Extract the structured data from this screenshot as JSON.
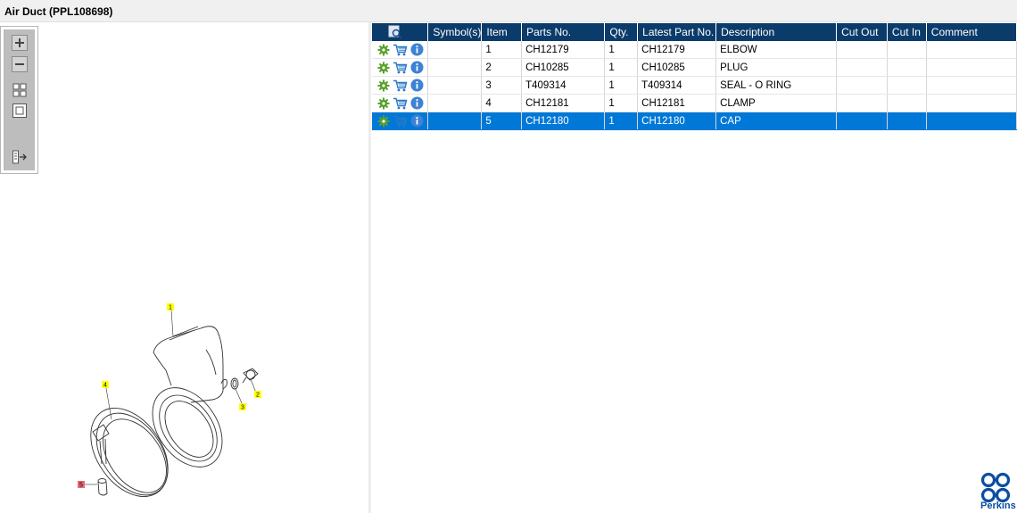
{
  "window": {
    "title": "Air Duct (PPL108698)"
  },
  "toolbox": {
    "buttons": [
      "zoom-in-icon",
      "zoom-out-icon",
      "grid-view-icon",
      "fit-view-icon",
      "toggle-panel-icon"
    ]
  },
  "diagram": {
    "callouts": [
      "1",
      "2",
      "3",
      "4",
      "5"
    ]
  },
  "table": {
    "headers": {
      "actions": "",
      "symbols": "Symbol(s)",
      "item": "Item",
      "parts_no": "Parts No.",
      "qty": "Qty.",
      "latest": "Latest Part No.",
      "description": "Description",
      "cut_out": "Cut Out",
      "cut_in": "Cut In",
      "comment": "Comment"
    },
    "rows": [
      {
        "symbols": "",
        "item": "1",
        "parts_no": "CH12179",
        "qty": "1",
        "latest": "CH12179",
        "description": "ELBOW",
        "cut_out": "",
        "cut_in": "",
        "comment": ""
      },
      {
        "symbols": "",
        "item": "2",
        "parts_no": "CH10285",
        "qty": "1",
        "latest": "CH10285",
        "description": "PLUG",
        "cut_out": "",
        "cut_in": "",
        "comment": ""
      },
      {
        "symbols": "",
        "item": "3",
        "parts_no": "T409314",
        "qty": "1",
        "latest": "T409314",
        "description": "SEAL - O RING",
        "cut_out": "",
        "cut_in": "",
        "comment": ""
      },
      {
        "symbols": "",
        "item": "4",
        "parts_no": "CH12181",
        "qty": "1",
        "latest": "CH12181",
        "description": "CLAMP",
        "cut_out": "",
        "cut_in": "",
        "comment": ""
      },
      {
        "symbols": "",
        "item": "5",
        "parts_no": "CH12180",
        "qty": "1",
        "latest": "CH12180",
        "description": "CAP",
        "cut_out": "",
        "cut_in": "",
        "comment": ""
      }
    ],
    "selected_row": 4,
    "row_icons": [
      "settings-gear-icon",
      "cart-icon",
      "info-icon"
    ]
  },
  "brand": {
    "name": "Perkins"
  },
  "colors": {
    "header": "#0b3b6a",
    "selection": "#0078d7",
    "callout_yellow": "#ffff00",
    "callout_red": "#e8697a"
  }
}
